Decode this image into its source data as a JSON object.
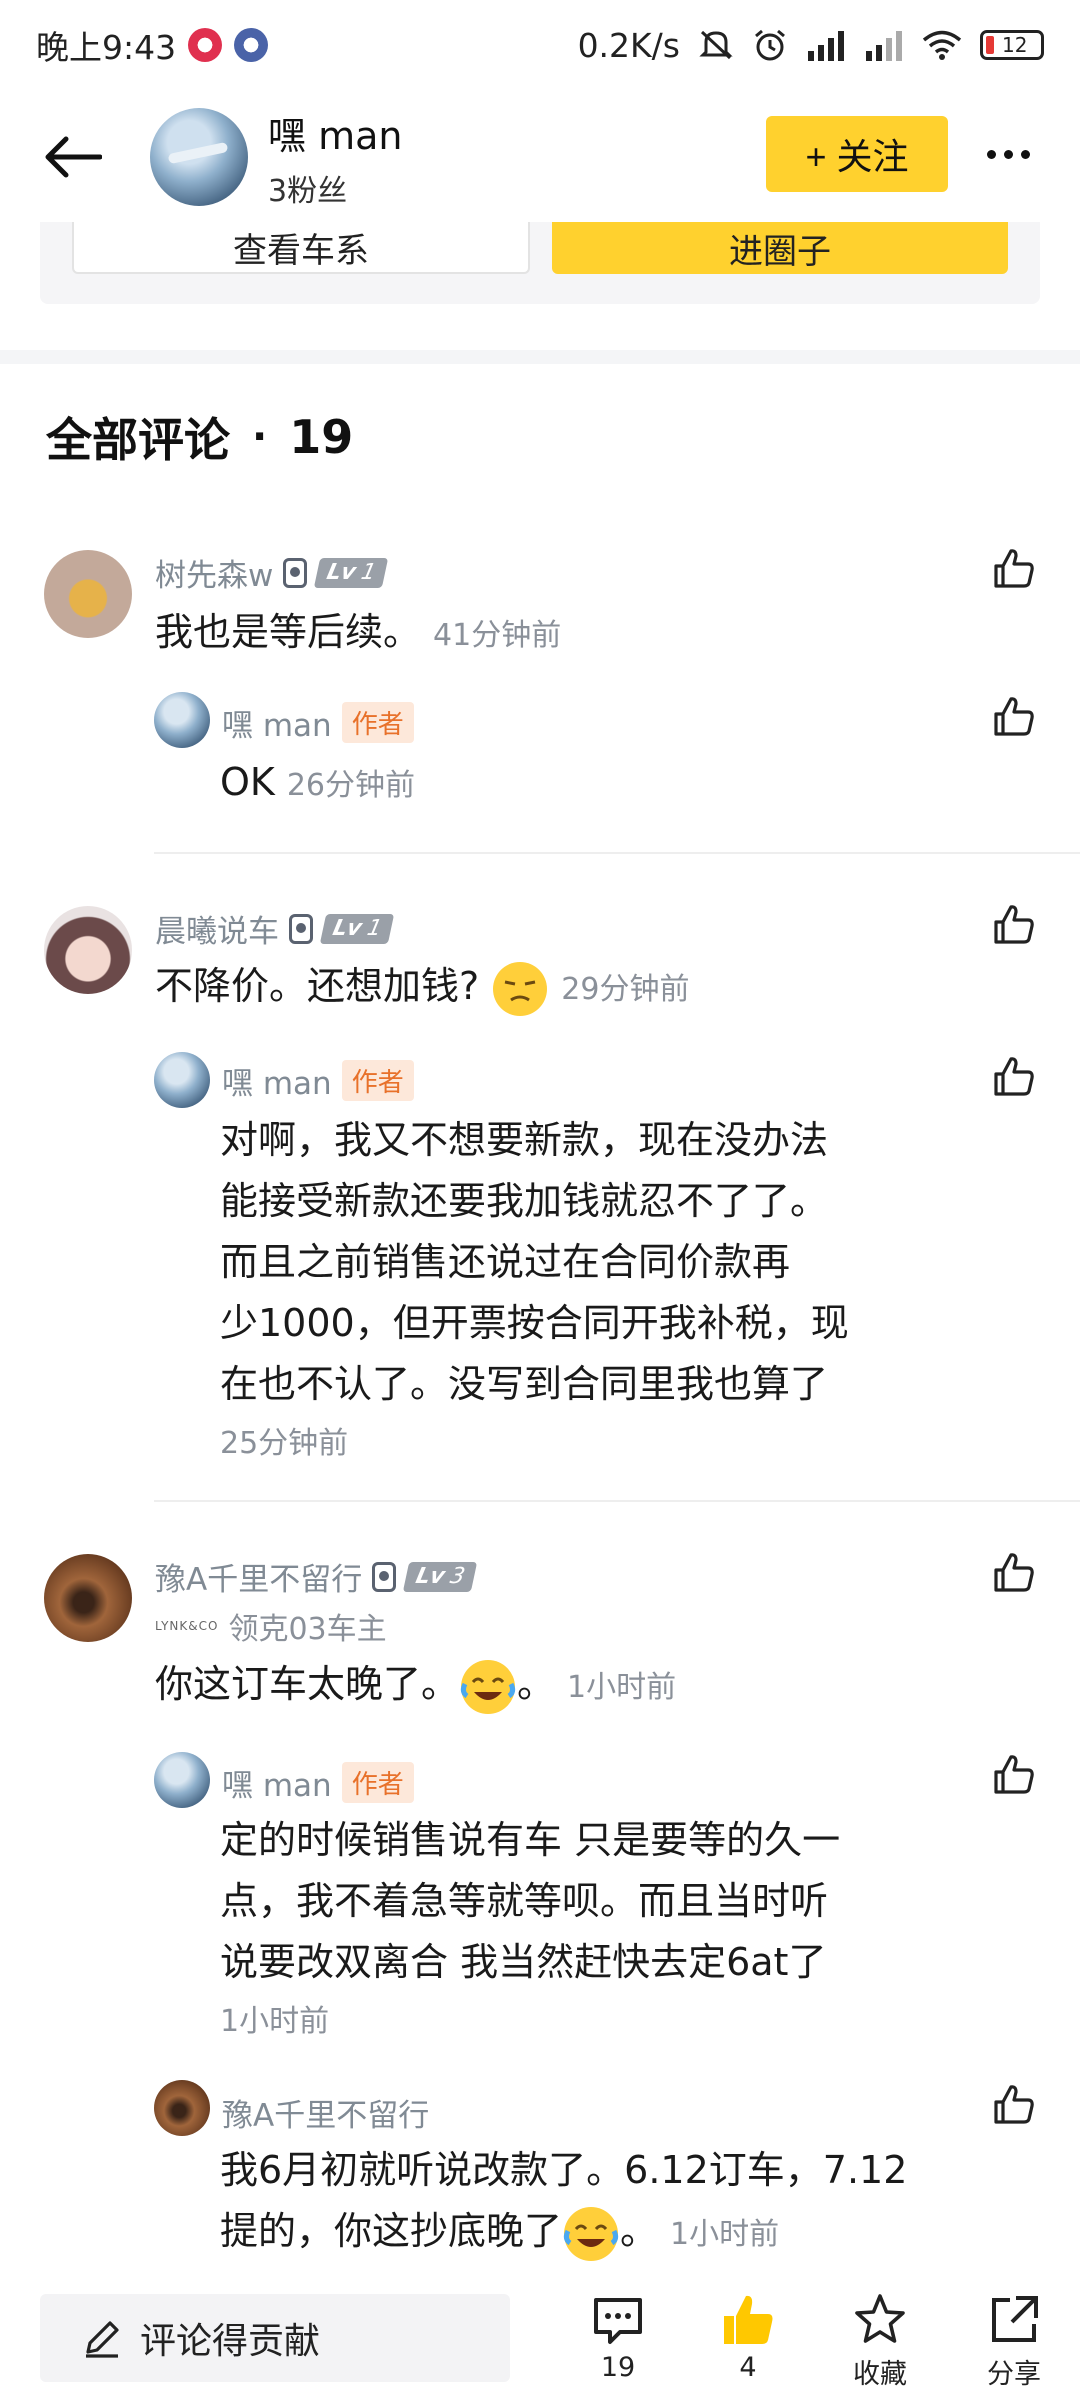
{
  "status_bar": {
    "time": "晚上9:43",
    "net_speed": "0.2K/s",
    "battery": "12"
  },
  "header": {
    "name": "嘿 man",
    "fans": "3粉丝",
    "follow_label": "+ 关注"
  },
  "card": {
    "series_label": "查看车系",
    "circle_label": "进圈子"
  },
  "comments_heading": {
    "title": "全部评论",
    "separator": "·",
    "count": "19"
  },
  "comments": [
    {
      "user": "树先森w",
      "level": "1",
      "text": "我也是等后续。",
      "time": "41分钟前",
      "reply": {
        "user": "嘿 man",
        "author_tag": "作者",
        "text": "OK",
        "time": "26分钟前"
      }
    },
    {
      "user": "晨曦说车",
      "level": "1",
      "text": "不降价。还想加钱?",
      "time": "29分钟前",
      "reply": {
        "user": "嘿 man",
        "author_tag": "作者",
        "lines": [
          "对啊，我又不想要新款，现在没办法",
          "能接受新款还要我加钱就忍不了了。",
          "而且之前销售还说过在合同价款再",
          "少1000，但开票按合同开我补税，现",
          "在也不认了。没写到合同里我也算了"
        ],
        "time": "25分钟前"
      }
    },
    {
      "user": "豫A千里不留行",
      "level": "3",
      "owner_brand": "LYNK&CO",
      "owner_label": "领克03车主",
      "text_before": "你这订车太晚了。",
      "text_after": "。",
      "time": "1小时前",
      "reply": {
        "user": "嘿 man",
        "author_tag": "作者",
        "lines": [
          "定的时候销售说有车 只是要等的久一",
          "点，我不着急等就等呗。而且当时听",
          "说要改双离合 我当然赶快去定6at了"
        ],
        "time": "1小时前"
      },
      "reply2": {
        "user": "豫A千里不留行",
        "line1": "我6月初就听说改款了。6.12订车，7.12",
        "line2_before": "提的，你这抄底晚了",
        "line2_after": "。",
        "time": "1小时前"
      }
    }
  ],
  "bottom_bar": {
    "input_placeholder": "评论得贡献",
    "comments_count": "19",
    "likes_count": "4",
    "collect_label": "收藏",
    "share_label": "分享"
  },
  "colors": {
    "accent": "#ffd12e",
    "author_tag": "#e8712a",
    "muted": "#8a9099"
  }
}
